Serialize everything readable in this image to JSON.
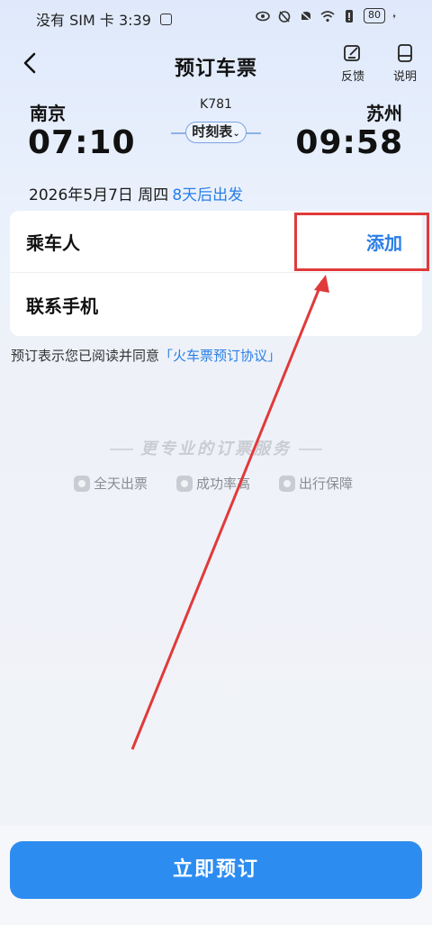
{
  "status_bar": {
    "carrier_time": "没有 SIM 卡 3:39",
    "battery": "80"
  },
  "nav": {
    "title": "预订车票",
    "feedback_label": "反馈",
    "help_label": "说明"
  },
  "train": {
    "from_station": "南京",
    "to_station": "苏州",
    "depart_time": "07:10",
    "arrive_time": "09:58",
    "train_number": "K781",
    "timetable_label": "时刻表"
  },
  "date": {
    "text": "2026年5月7日 周四",
    "hint": "8天后出发"
  },
  "form": {
    "passenger_label": "乘车人",
    "add_label": "添加",
    "phone_label": "联系手机"
  },
  "agreement": {
    "prefix": "预订表示您已阅读并同意",
    "link": "「火车票预订协议」"
  },
  "service": {
    "title": "更专业的订票服务",
    "features": [
      "全天出票",
      "成功率高",
      "出行保障"
    ]
  },
  "submit_label": "立即预订",
  "colors": {
    "accent": "#2d8cf0",
    "link": "#2a7ee6",
    "annotation": "#e03a3a"
  }
}
